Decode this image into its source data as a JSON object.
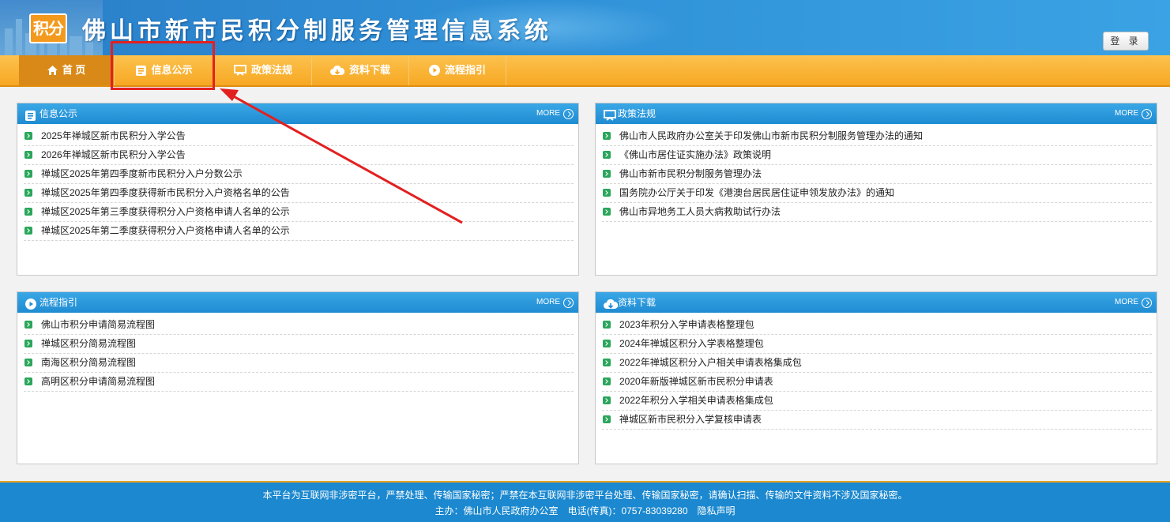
{
  "header": {
    "logo_text": "积分",
    "site_title": "佛山市新市民积分制服务管理信息系统",
    "login_label": "登 录"
  },
  "nav": {
    "items": [
      {
        "label": "首 页",
        "icon": "home-icon"
      },
      {
        "label": "信息公示",
        "icon": "notice-icon"
      },
      {
        "label": "政策法规",
        "icon": "screen-icon"
      },
      {
        "label": "资料下载",
        "icon": "cloud-download-icon"
      },
      {
        "label": "流程指引",
        "icon": "play-circle-icon"
      }
    ],
    "active_index": 0
  },
  "panels": {
    "info": {
      "title": "信息公示",
      "more": "MORE",
      "items": [
        "2025年禅城区新市民积分入学公告",
        "2026年禅城区新市民积分入学公告",
        "禅城区2025年第四季度新市民积分入户分数公示",
        "禅城区2025年第四季度获得新市民积分入户资格名单的公告",
        "禅城区2025年第三季度获得积分入户资格申请人名单的公示",
        "禅城区2025年第二季度获得积分入户资格申请人名单的公示"
      ]
    },
    "policy": {
      "title": "政策法规",
      "more": "MORE",
      "items": [
        "佛山市人民政府办公室关于印发佛山市新市民积分制服务管理办法的通知",
        "《佛山市居住证实施办法》政策说明",
        "佛山市新市民积分制服务管理办法",
        "国务院办公厅关于印发《港澳台居民居住证申领发放办法》的通知",
        "佛山市异地务工人员大病救助试行办法"
      ]
    },
    "process": {
      "title": "流程指引",
      "more": "MORE",
      "items": [
        "佛山市积分申请简易流程图",
        "禅城区积分简易流程图",
        "南海区积分简易流程图",
        "高明区积分申请简易流程图"
      ]
    },
    "download": {
      "title": "资料下载",
      "more": "MORE",
      "items": [
        "2023年积分入学申请表格整理包",
        "2024年禅城区积分入学表格整理包",
        "2022年禅城区积分入户相关申请表格集成包",
        "2020年新版禅城区新市民积分申请表",
        "2022年积分入学相关申请表格集成包",
        "禅城区新市民积分入学复核申请表"
      ]
    }
  },
  "footer": {
    "line1": "本平台为互联网非涉密平台，严禁处理、传输国家秘密；严禁在本互联网非涉密平台处理、传输国家秘密，请确认扫描、传输的文件资料不涉及国家秘密。",
    "line2": "主办：佛山市人民政府办公室　电话(传真)：0757-83039280　隐私声明"
  },
  "colors": {
    "header_blue": "#2a7fc9",
    "nav_orange": "#f7a823",
    "panel_head_blue": "#1f8bd2",
    "bullet_green": "#2aa65a",
    "annotation_red": "#e32020"
  }
}
